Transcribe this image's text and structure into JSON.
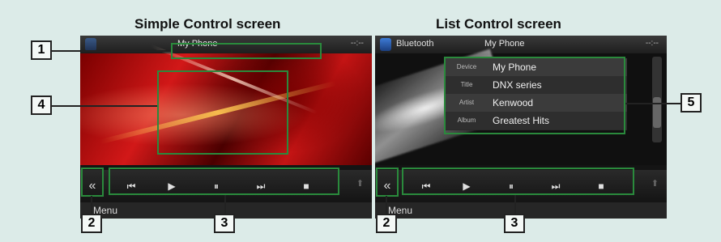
{
  "left": {
    "title": "Simple Control screen",
    "device": "My Phone",
    "clock": "--:--",
    "menu": "Menu",
    "controls": [
      "⏮",
      "▶",
      "⏸",
      "⏭",
      "■"
    ]
  },
  "right": {
    "title": "List Control screen",
    "source": "Bluetooth",
    "device": "My Phone",
    "clock": "--:--",
    "menu": "Menu",
    "info": [
      {
        "label": "Device",
        "value": "My Phone"
      },
      {
        "label": "Title",
        "value": "DNX series"
      },
      {
        "label": "Artist",
        "value": "Kenwood"
      },
      {
        "label": "Album",
        "value": "Greatest Hits"
      }
    ],
    "controls": [
      "⏮",
      "▶",
      "⏸",
      "⏭",
      "■"
    ]
  },
  "callouts": {
    "c1": "1",
    "c2": "2",
    "c3": "3",
    "c4": "4",
    "c5": "5"
  },
  "icons": {
    "back": "«",
    "up": "⬆"
  },
  "colors": {
    "highlight": "#2a8a3c",
    "background": "#dcebe8"
  }
}
